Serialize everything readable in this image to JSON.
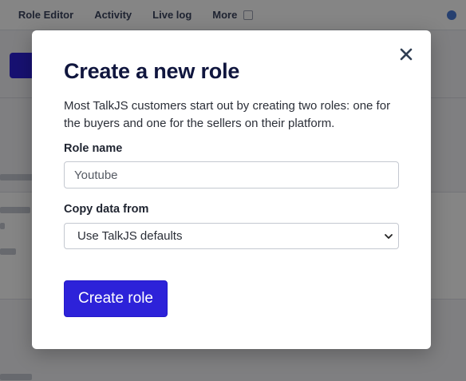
{
  "background": {
    "nav_items": [
      "Role Editor",
      "Activity",
      "Live log",
      "More"
    ]
  },
  "modal": {
    "title": "Create a new role",
    "description": "Most TalkJS customers start out by creating two roles: one for the buyers and one for the sellers on their platform.",
    "close_icon": "close-icon",
    "role_name": {
      "label": "Role name",
      "value": "Youtube"
    },
    "copy_data": {
      "label": "Copy data from",
      "selected": "Use TalkJS defaults",
      "arrow_icon": "chevron-down-icon"
    },
    "submit_label": "Create role"
  },
  "colors": {
    "primary": "#2d22d9",
    "title": "#10163e",
    "overlay": "rgba(0,0,0,0.48)"
  }
}
